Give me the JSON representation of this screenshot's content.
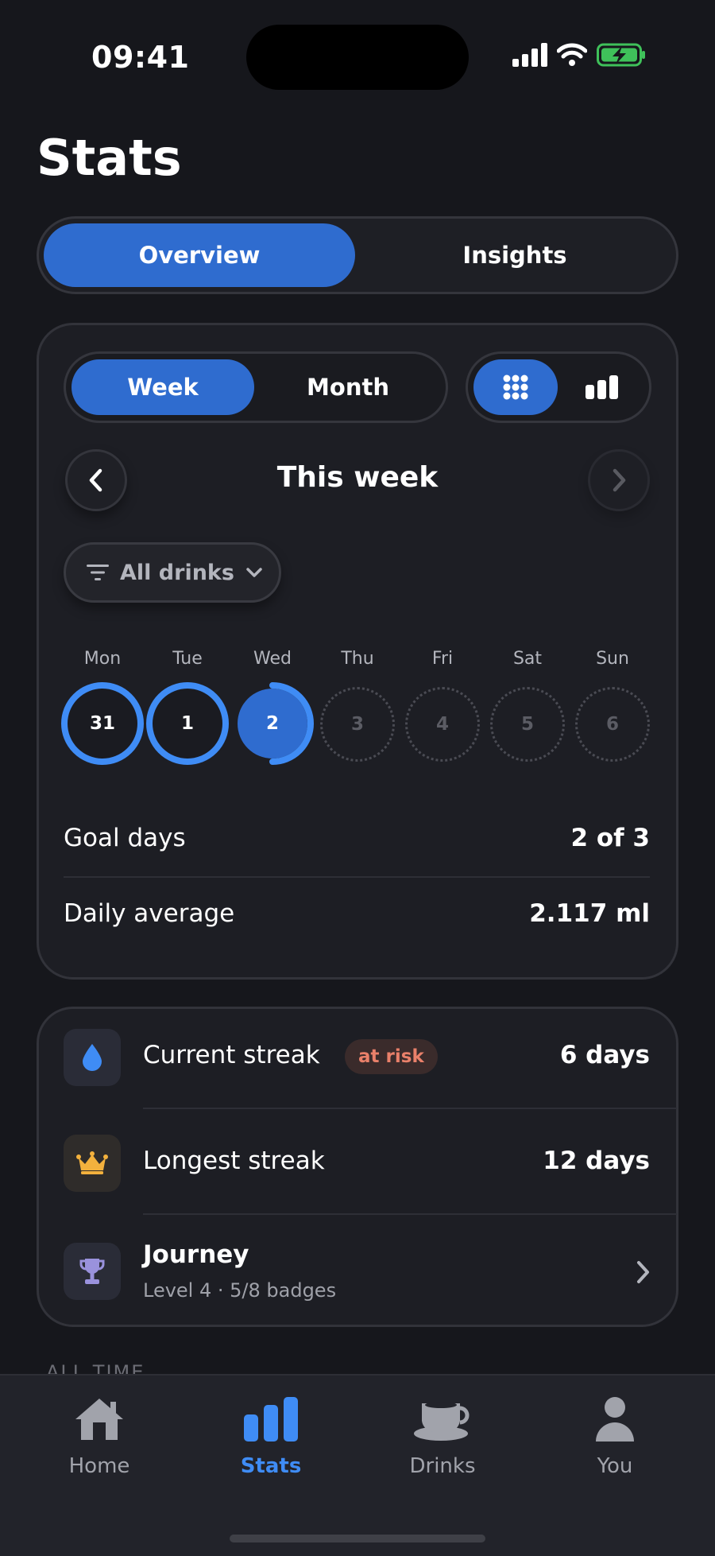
{
  "status_bar": {
    "time": "09:41"
  },
  "page": {
    "title": "Stats"
  },
  "main_tabs": [
    {
      "label": "Overview",
      "active": true
    },
    {
      "label": "Insights",
      "active": false
    }
  ],
  "period_toggle": [
    {
      "label": "Week",
      "active": true
    },
    {
      "label": "Month",
      "active": false
    }
  ],
  "view_toggle": [
    {
      "icon": "grid-icon",
      "active": true
    },
    {
      "icon": "bar-chart-icon",
      "active": false
    }
  ],
  "period_nav": {
    "label": "This week"
  },
  "filter": {
    "label": "All drinks"
  },
  "week": [
    {
      "day": "Mon",
      "date": "31",
      "state": "complete",
      "progress": 1.0
    },
    {
      "day": "Tue",
      "date": "1",
      "state": "complete",
      "progress": 1.0
    },
    {
      "day": "Wed",
      "date": "2",
      "state": "today",
      "progress": 0.5
    },
    {
      "day": "Thu",
      "date": "3",
      "state": "future",
      "progress": 0
    },
    {
      "day": "Fri",
      "date": "4",
      "state": "future",
      "progress": 0
    },
    {
      "day": "Sat",
      "date": "5",
      "state": "future",
      "progress": 0
    },
    {
      "day": "Sun",
      "date": "6",
      "state": "future",
      "progress": 0
    }
  ],
  "summary": {
    "goal_days_label": "Goal days",
    "goal_days_value": "2 of 3",
    "daily_avg_label": "Daily average",
    "daily_avg_value": "2.117 ml"
  },
  "streaks": {
    "current_label": "Current streak",
    "current_badge": "at risk",
    "current_value": "6 days",
    "longest_label": "Longest streak",
    "longest_value": "12 days",
    "journey_title": "Journey",
    "journey_subtitle": "Level 4 · 5/8 badges"
  },
  "section_peek": "ALL TIME",
  "tab_bar": [
    {
      "label": "Home",
      "icon": "home-icon",
      "active": false
    },
    {
      "label": "Stats",
      "icon": "stats-icon",
      "active": true
    },
    {
      "label": "Drinks",
      "icon": "cup-icon",
      "active": false
    },
    {
      "label": "You",
      "icon": "person-icon",
      "active": false
    }
  ],
  "colors": {
    "accent": "#2f6ccf",
    "ring": "#3f8cf5",
    "background": "#16171c",
    "card": "#1d1e24",
    "warning": "#e9806a"
  }
}
